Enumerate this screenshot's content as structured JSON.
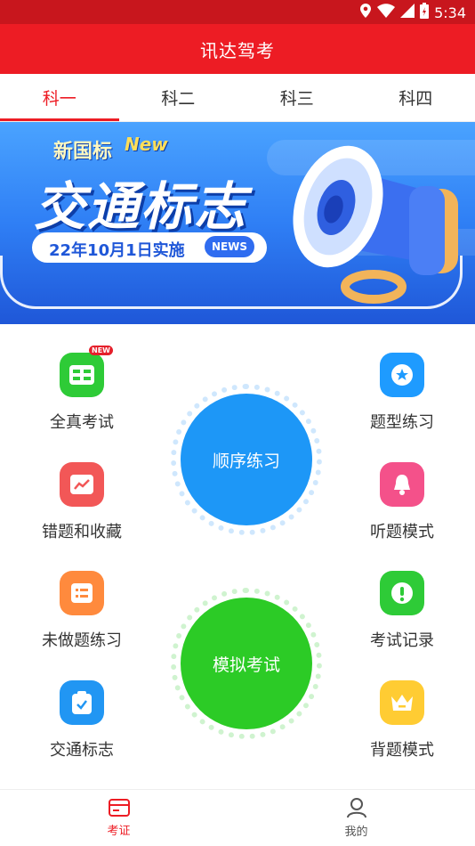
{
  "statusbar": {
    "time": "5:34",
    "icons": [
      "location-icon",
      "wifi-icon",
      "signal-icon",
      "battery-icon"
    ]
  },
  "app": {
    "title": "讯达驾考"
  },
  "tabs": [
    {
      "label": "科一",
      "active": true
    },
    {
      "label": "科二",
      "active": false
    },
    {
      "label": "科三",
      "active": false
    },
    {
      "label": "科四",
      "active": false
    }
  ],
  "banner": {
    "tag": "新国标",
    "new_tag": "New",
    "title": "交通标志",
    "subtitle": "22年10月1日实施",
    "news_badge": "NEWS"
  },
  "features": {
    "left": [
      {
        "label": "全真考试",
        "icon": "exam-card-icon",
        "color": "#2ecb37",
        "badge": "NEW"
      },
      {
        "label": "错题和收藏",
        "icon": "trend-chart-icon",
        "color": "#f25757"
      },
      {
        "label": "未做题练习",
        "icon": "list-icon",
        "color": "#ff8a3d"
      },
      {
        "label": "交通标志",
        "icon": "clipboard-check-icon",
        "color": "#2196f3"
      }
    ],
    "right": [
      {
        "label": "题型练习",
        "icon": "star-badge-icon",
        "color": "#1e9bff"
      },
      {
        "label": "听题模式",
        "icon": "bell-icon",
        "color": "#f4518a"
      },
      {
        "label": "考试记录",
        "icon": "exclamation-icon",
        "color": "#2ecb37"
      },
      {
        "label": "背题模式",
        "icon": "crown-icon",
        "color": "#ffcc33"
      }
    ]
  },
  "actions": {
    "sequential": {
      "label": "顺序练习",
      "color": "#1d97f7"
    },
    "mock": {
      "label": "模拟考试",
      "color": "#2ccb26"
    }
  },
  "bottom_nav": [
    {
      "label": "考证",
      "icon": "card-icon",
      "active": true
    },
    {
      "label": "我的",
      "icon": "person-icon",
      "active": false
    }
  ]
}
